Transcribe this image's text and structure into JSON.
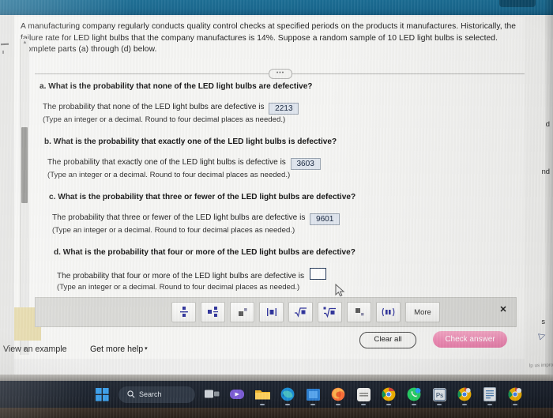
{
  "app": {
    "header_color": "#1b6d94",
    "accent_check_color": "#ef8cb5",
    "answer_box_fill": "#dfe5ee"
  },
  "problem": {
    "statement": "A manufacturing company regularly conducts quality control checks at specified periods on the products it manufactures. Historically, the failure rate for LED light bulbs that the company manufactures is 14%. Suppose a random sample of 10 LED light bulbs is selected. Complete parts (a) through (d) below.",
    "divider_pill": "•••"
  },
  "parts": [
    {
      "label": "a.",
      "question": "What is the probability that none of the LED light bulbs are defective?",
      "answer_prompt": "The probability that none of the LED light bulbs are defective is",
      "answer_value": "2213",
      "answer_empty": false,
      "note": "(Type an integer or a decimal. Round to four decimal places as needed.)"
    },
    {
      "label": "b.",
      "question": "What is the probability that exactly one of the LED light bulbs is defective?",
      "answer_prompt": "The probability that exactly one of the LED light bulbs is defective is",
      "answer_value": "3603",
      "answer_empty": false,
      "note": "(Type an integer or a decimal. Round to four decimal places as needed.)"
    },
    {
      "label": "c.",
      "question": "What is the probability that three or fewer of the LED light bulbs are defective?",
      "answer_prompt": "The probability that three or fewer of the LED light bulbs are defective is",
      "answer_value": "9601",
      "answer_empty": false,
      "note": "(Type an integer or a decimal. Round to four decimal places as needed.)"
    },
    {
      "label": "d.",
      "question": "What is the probability that four or more of the LED light bulbs are defective?",
      "answer_prompt": "The probability that four or more of the LED light bulbs are defective is",
      "answer_value": "",
      "answer_empty": true,
      "note": "(Type an integer or a decimal. Round to four decimal places as needed.)"
    }
  ],
  "math_toolbar": {
    "buttons": [
      {
        "name": "fraction-button",
        "glyph": "fraction"
      },
      {
        "name": "mixed-number-button",
        "glyph": "mixed-number"
      },
      {
        "name": "exponent-button",
        "glyph": "exponent"
      },
      {
        "name": "absolute-value-button",
        "glyph": "absolute-value"
      },
      {
        "name": "square-root-button",
        "glyph": "square-root"
      },
      {
        "name": "nth-root-button",
        "glyph": "nth-root"
      },
      {
        "name": "subscript-button",
        "glyph": "subscript"
      },
      {
        "name": "interval-notation-button",
        "glyph": "interval"
      }
    ],
    "more_label": "More",
    "close_label": "✕"
  },
  "actions": {
    "clear_all": "Clear all",
    "check_answer": "Check answer"
  },
  "footer": {
    "view_example": "View an example",
    "get_more_help": "Get more help",
    "get_more_help_caret": "▾"
  },
  "right_bleed": {
    "words": [
      "d",
      "nd",
      "s"
    ],
    "footnote": "lp us impro"
  },
  "taskbar": {
    "search_label": "Search",
    "search_icon": "search-icon",
    "items": [
      {
        "name": "start-button",
        "label": "Windows"
      },
      {
        "name": "search-button",
        "label": "Search"
      },
      {
        "name": "task-view-button",
        "label": "Task View"
      },
      {
        "name": "teams-button",
        "label": "Microsoft Teams"
      },
      {
        "name": "file-explorer-button",
        "label": "File Explorer"
      },
      {
        "name": "edge-button",
        "label": "Microsoft Edge"
      },
      {
        "name": "store-button",
        "label": "Microsoft Store"
      },
      {
        "name": "vscode-button",
        "label": "Visual Studio Code"
      },
      {
        "name": "firefox-button",
        "label": "Firefox"
      },
      {
        "name": "whiteapp-button",
        "label": "App"
      },
      {
        "name": "chrome-button",
        "label": "Google Chrome"
      },
      {
        "name": "whatsapp-button",
        "label": "WhatsApp"
      },
      {
        "name": "photoshop-button",
        "label": "Ps"
      },
      {
        "name": "chrome2-button",
        "label": "Google Chrome"
      },
      {
        "name": "notes-button",
        "label": "Notes"
      },
      {
        "name": "chrome3-button",
        "label": "Google Chrome"
      }
    ]
  }
}
